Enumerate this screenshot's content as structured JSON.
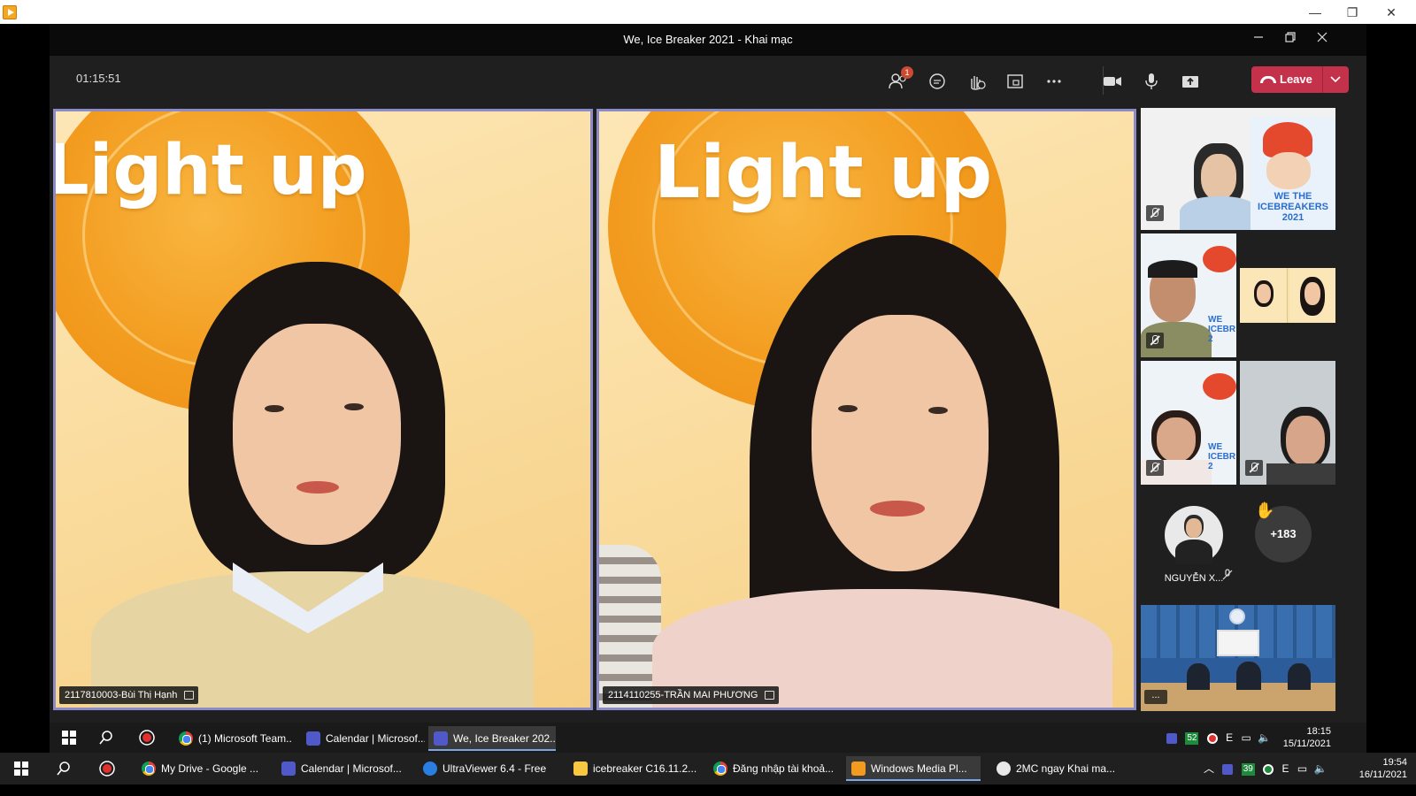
{
  "wmp": {
    "minimize": "—",
    "restore": "❐",
    "close": "✕"
  },
  "meeting": {
    "title": "We, Ice Breaker 2021 - Khai mạc",
    "elapsed": "01:15:51",
    "participants_badge": "1",
    "leave_label": "Leave"
  },
  "stage": {
    "banner_text": "Light up",
    "tiles": [
      {
        "name": "2117810003-Bùi Thị Hạnh"
      },
      {
        "name": "2114110255-TRẦN MAI PHƯƠNG"
      }
    ]
  },
  "gallery": {
    "avatar_name": "NGUYỄN X...",
    "overflow_count": "+183",
    "hand_raise": "✋",
    "thumb_banner": "WE THE ICEBREAKERS 2021",
    "thumb_banner_cut": "WE ICEBR 2",
    "room_more": "..."
  },
  "taskbar_inner": {
    "items": [
      "(1) Microsoft Team...",
      "Calendar | Microsof...",
      "We, Ice Breaker 202..."
    ],
    "tray_badge": "52",
    "tray_lang": "E",
    "time": "18:15",
    "date": "15/11/2021"
  },
  "taskbar_outer": {
    "items": [
      "My Drive - Google ...",
      "Calendar | Microsof...",
      "UltraViewer 6.4 - Free",
      "icebreaker C16.11.2...",
      "Đăng nhập tài khoả...",
      "Windows Media Pl...",
      "2MC ngay Khai ma..."
    ],
    "tray_badge": "39",
    "tray_lang": "E",
    "time": "19:54",
    "date": "16/11/2021"
  }
}
